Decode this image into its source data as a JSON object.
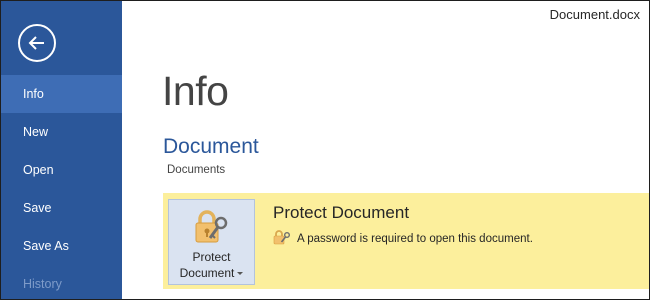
{
  "window": {
    "document_title": "Document.docx"
  },
  "sidebar": {
    "back_icon": "back-arrow-circle-icon",
    "items": [
      {
        "label": "Info",
        "active": true
      },
      {
        "label": "New"
      },
      {
        "label": "Open"
      },
      {
        "label": "Save"
      },
      {
        "label": "Save As"
      },
      {
        "label": "History",
        "dimmed": true
      }
    ]
  },
  "main": {
    "title": "Info",
    "section_title": "Document",
    "path": "Documents",
    "protect": {
      "button_line1": "Protect",
      "button_line2": "Document",
      "heading": "Protect Document",
      "description": "A password is required to open this document.",
      "icon": "lock-key-icon"
    }
  },
  "colors": {
    "sidebar": "#2b579a",
    "sidebar_active": "#3e6db5",
    "accent": "#2b579a",
    "protect_band": "#fcef9c",
    "protect_button": "#dae3f1"
  }
}
